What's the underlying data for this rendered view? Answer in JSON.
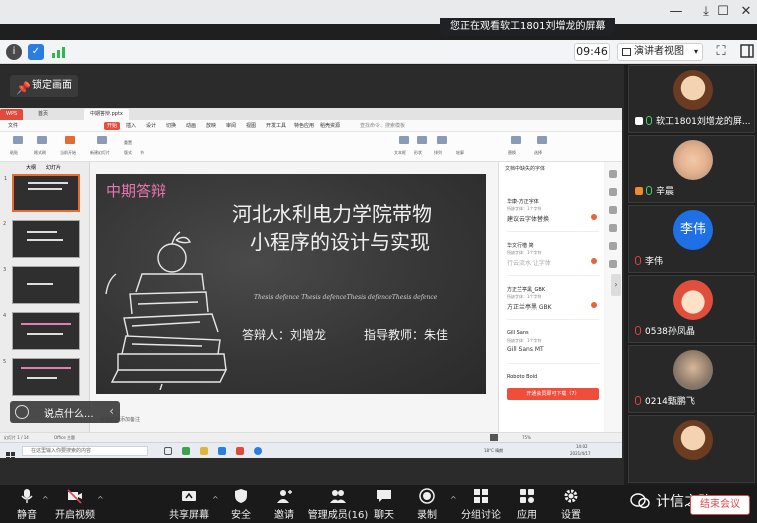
{
  "window": {
    "banner": "您正在观看软工1801刘增龙的屏幕",
    "minimize": "—",
    "maximize": "☐",
    "close": "✕"
  },
  "meeting_bar": {
    "timer": "09:46",
    "view_button": "演讲者视图"
  },
  "stage": {
    "lock_label": "锁定画面",
    "chat_placeholder": "说点什么..."
  },
  "wps": {
    "tabs": [
      "WPS",
      "首页",
      "中期答辩.pptx"
    ],
    "menu": [
      "文件",
      "开始",
      "插入",
      "设计",
      "切换",
      "动画",
      "放映",
      "审阅",
      "视图",
      "开发工具",
      "特色应用",
      "稻壳资源",
      "查找命令、搜索模板"
    ],
    "menu_active": "开始",
    "ribbon_labels": [
      "粘贴",
      "格式刷",
      "当前开始",
      "新建幻灯片",
      "版式",
      "节",
      "重置",
      "文本框",
      "形状",
      "排列",
      "轮廓",
      "替换",
      "选择"
    ],
    "thumb_tabs": [
      "大纲",
      "幻灯片"
    ],
    "notes": "单击此处添加备注",
    "status_left": "幻灯片 1 / 14",
    "status_theme": "Office 主题",
    "status_zoom": "75%",
    "taskbar_search": "在这里输入你要搜索的内容",
    "taskbar_weather": "18°C 晴朗",
    "taskbar_time": "14:02",
    "taskbar_date": "2021/4/17"
  },
  "slide": {
    "label": "中期答辩",
    "title_line1": "河北水利电力学院带物",
    "title_line2": "小程序的设计与实现",
    "subtitle": "Thesis defence Thesis defenceThesis defenceThesis defence",
    "defender": "答辩人：刘增龙",
    "advisor": "指导教师：朱佳"
  },
  "font_panel": {
    "title": "文档中缺失的字体",
    "items": [
      {
        "name": "华康-方正字体",
        "sub": "所缺字体：1个字符",
        "preview": "建议云字体替换"
      },
      {
        "name": "华文行楷 简",
        "sub": "所缺字体：1个字符",
        "preview": "行云流水 让字体"
      },
      {
        "name": "方正兰亭黑_GBK",
        "sub": "所缺字体：1个字符",
        "preview": "方正兰亭黑 GBK"
      },
      {
        "name": "Gill Sans",
        "sub": "所缺字体：1个字符",
        "preview": "Gill Sans MT"
      },
      {
        "name": "Roboto Bold",
        "sub": "",
        "preview": ""
      }
    ],
    "download_button": "开通会员即可下载（7）"
  },
  "participants": [
    {
      "name": "软工1801刘增龙的屏...",
      "mic": "on",
      "avatar": "cartoon"
    },
    {
      "name": "辛晨",
      "mic": "on",
      "avatar": "photo"
    },
    {
      "name": "李伟",
      "mic": "off",
      "avatar": "initials",
      "initials": "李伟",
      "avatar_color": "#1f6fe5"
    },
    {
      "name": "0538孙凤晶",
      "mic": "off",
      "avatar": "cartoon"
    },
    {
      "name": "0214甄鹏飞",
      "mic": "off",
      "avatar": "photo"
    },
    {
      "name": "",
      "mic": "off",
      "avatar": "cartoon"
    }
  ],
  "toolbar": {
    "mute": "静音",
    "video": "开启视频",
    "share": "共享屏幕",
    "security": "安全",
    "invite": "邀请",
    "members": "管理成员(16)",
    "chat": "聊天",
    "record": "录制",
    "breakout": "分组讨论",
    "apps": "应用",
    "settings": "设置",
    "end": "结束会议"
  },
  "watermark": "计信之路",
  "colors": {
    "accent_red": "#e14a4a",
    "slide_pink": "#e776b1",
    "wps_red": "#e84d3d",
    "mic_green": "#4bd36b",
    "avatar_blue": "#1f6fe5"
  }
}
